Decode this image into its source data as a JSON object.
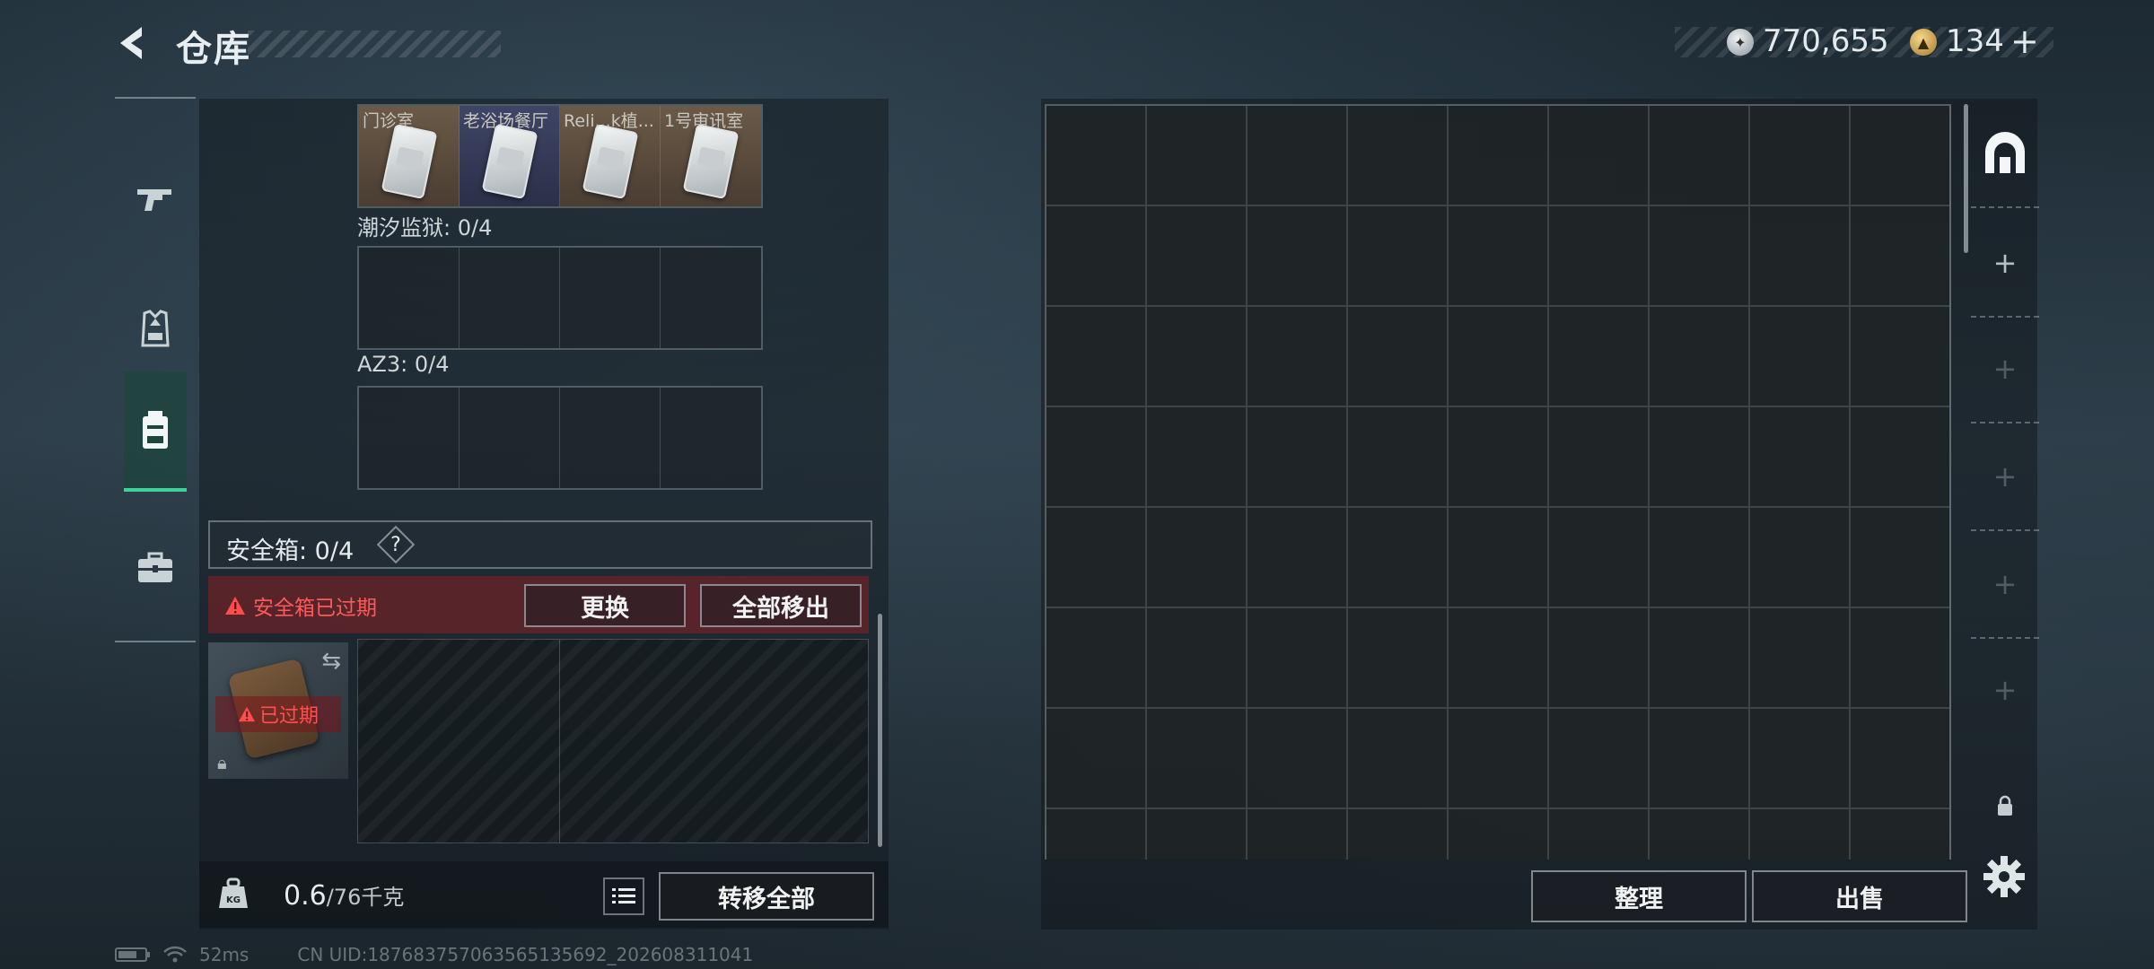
{
  "header": {
    "title": "仓库",
    "currency_silver": "770,655",
    "currency_gold": "134",
    "plus": "+"
  },
  "nav": {
    "items": [
      {
        "name": "weapons",
        "icon": "gun-icon"
      },
      {
        "name": "gear",
        "icon": "vest-icon"
      },
      {
        "name": "backpack",
        "icon": "backpack-icon",
        "active": true
      },
      {
        "name": "toolbox",
        "icon": "toolbox-icon"
      }
    ]
  },
  "key_cards": {
    "items": [
      {
        "label": "门诊室"
      },
      {
        "label": "老浴场餐厅"
      },
      {
        "label": "Reli...k植..."
      },
      {
        "label": "1号审讯室"
      }
    ]
  },
  "sections": {
    "tide_prison": "潮汐监狱: 0/4",
    "az3": "AZ3: 0/4"
  },
  "safe_box": {
    "title": "安全箱: 0/4",
    "help": "?",
    "warning": "安全箱已过期",
    "swap_label": "更换",
    "move_all_label": "全部移出",
    "expired_badge": "已过期"
  },
  "bottom_left": {
    "weight_current": "0.6",
    "weight_max": "/76千克",
    "transfer_all_label": "转移全部"
  },
  "right": {
    "sort_label": "整理",
    "sell_label": "出售"
  },
  "status": {
    "ping": "52ms",
    "uid": "CN UID:187683757063565135692_202608311041"
  },
  "colors": {
    "accent_green": "#3fd19a",
    "warning_red": "#ff5a5a"
  }
}
